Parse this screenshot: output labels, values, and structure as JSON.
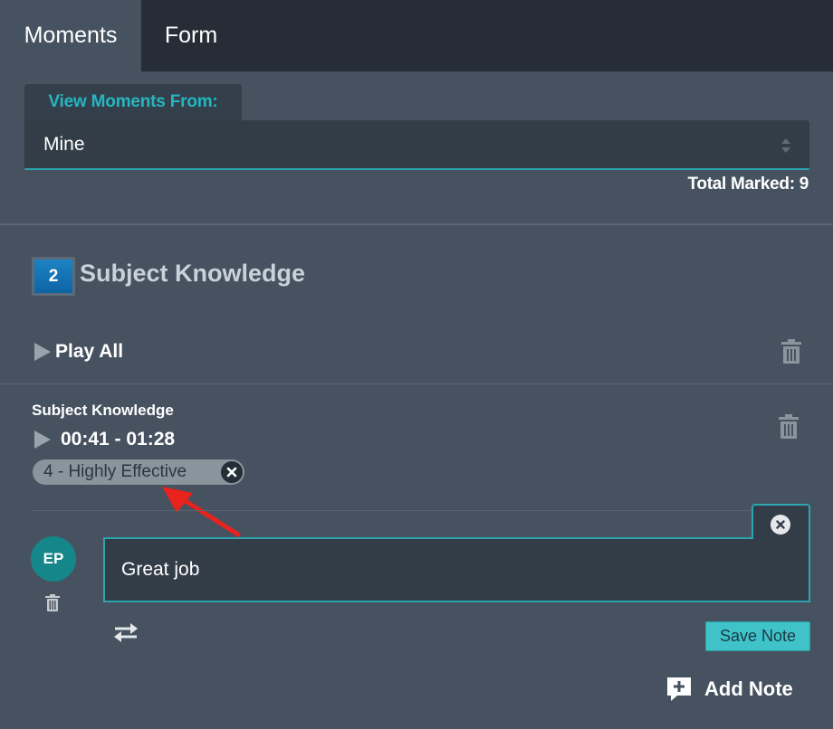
{
  "tabs": [
    {
      "label": "Moments",
      "active": true
    },
    {
      "label": "Form",
      "active": false
    }
  ],
  "filter": {
    "label": "View Moments From:",
    "selected": "Mine",
    "total_label": "Total Marked:",
    "total_count": "9"
  },
  "section": {
    "number": "2",
    "title": "Subject Knowledge",
    "play_all_label": "Play All"
  },
  "moment": {
    "label": "Subject Knowledge",
    "time_range": "00:41 - 01:28",
    "tag": "4 - Highly Effective"
  },
  "note": {
    "author_initials": "EP",
    "text": "Great job",
    "save_label": "Save Note",
    "add_note_label": "Add Note"
  },
  "colors": {
    "accent": "#2ca5ae",
    "background": "#465260",
    "tabbar": "#262d36",
    "annotation_arrow": "#e8221c"
  },
  "icons": [
    "trash-icon",
    "play-icon",
    "close-icon",
    "repeat-icon",
    "add-note-icon",
    "sort-arrows-icon"
  ]
}
